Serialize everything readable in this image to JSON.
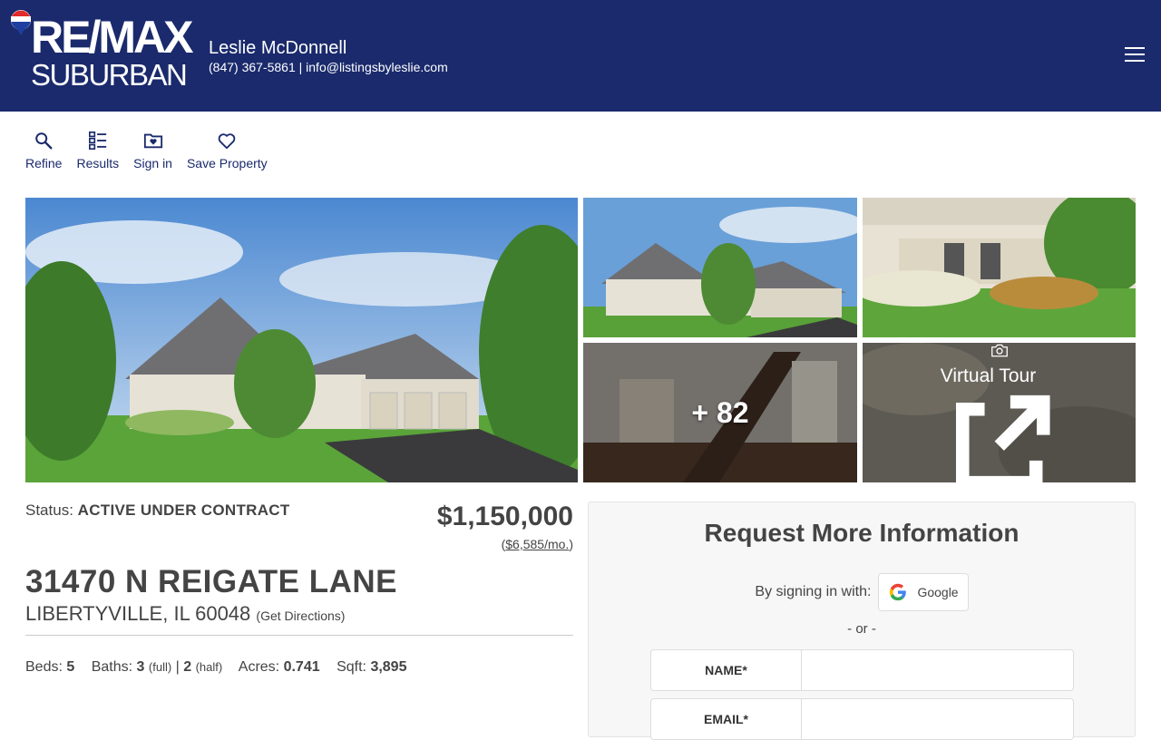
{
  "header": {
    "logo_line1": "RE/MAX",
    "logo_line2": "SUBURBAN",
    "agent_name": "Leslie McDonnell",
    "agent_contact": "(847) 367-5861 | info@listingsbyleslie.com",
    "brand_color": "#1a2a6c"
  },
  "toolbar": {
    "refine": "Refine",
    "results": "Results",
    "signin": "Sign in",
    "save": "Save Property"
  },
  "photos": {
    "more_count": "+ 82",
    "virtual_tour": "Virtual Tour"
  },
  "listing": {
    "status_label": "Status:",
    "status_value": "ACTIVE UNDER CONTRACT",
    "price": "$1,150,000",
    "monthly": "$6,585/mo.",
    "address": "31470 N REIGATE LANE",
    "city": "LIBERTYVILLE, IL 60048",
    "directions": "(Get Directions)",
    "beds_label": "Beds:",
    "beds": "5",
    "baths_label": "Baths:",
    "baths_full": "3",
    "full": "(full)",
    "baths_half": "2",
    "half": "(half)",
    "acres_label": "Acres:",
    "acres": "0.741",
    "sqft_label": "Sqft:",
    "sqft": "3,895"
  },
  "request": {
    "title": "Request More Information",
    "signin_text": "By signing in with:",
    "google": "Google",
    "or": "- or -",
    "name_label": "NAME*",
    "email_label": "EMAIL*"
  }
}
